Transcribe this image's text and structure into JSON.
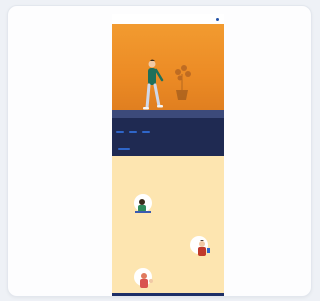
{
  "header": {
    "logo": "",
    "nav": [
      "",
      "",
      ""
    ],
    "language": ""
  },
  "hero": {
    "title": "",
    "subtitle": "",
    "intro": "",
    "buttons": [
      "",
      "",
      ""
    ],
    "question": "",
    "small_button": ""
  },
  "content": {
    "heading": "",
    "intro": "",
    "blocks": [
      "",
      "",
      ""
    ]
  },
  "footer": {
    "cols": [
      "",
      "",
      "",
      ""
    ]
  },
  "colors": {
    "hero_orange": "#ec8b25",
    "navy": "#1f2a52",
    "button_blue": "#2f66c9",
    "content_bg": "#fde5b0"
  }
}
